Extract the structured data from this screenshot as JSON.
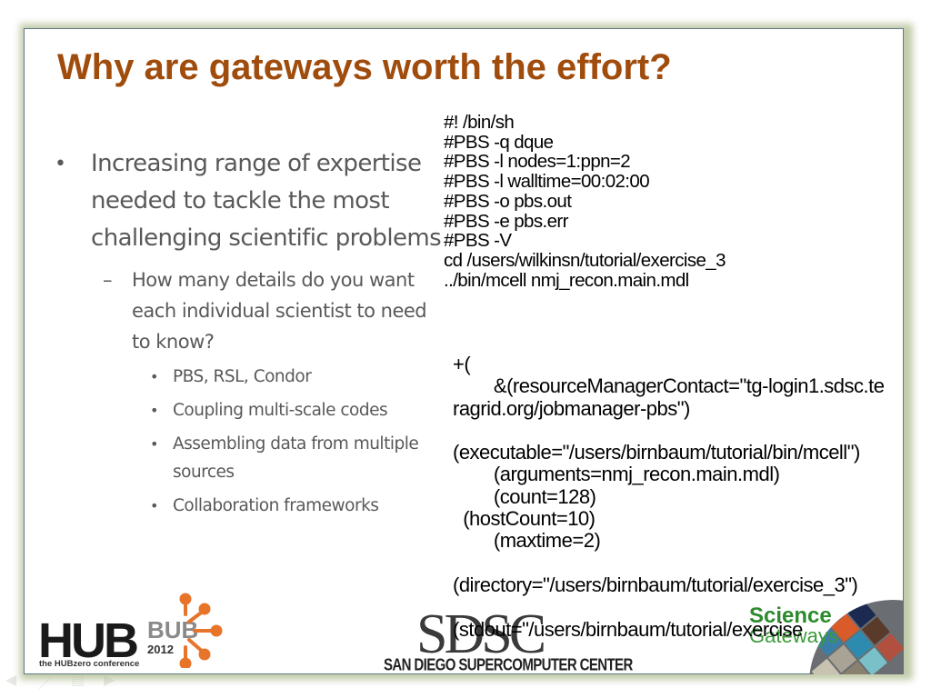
{
  "slide": {
    "title": "Why are gateways worth the effort?",
    "bullets": {
      "level1": {
        "marker": "•",
        "text": "Increasing range of expertise needed to tackle the most challenging scientific problems"
      },
      "level2": {
        "marker": "–",
        "text": "How many details do you want each individual scientist to need to know?"
      },
      "level3": [
        {
          "marker": "•",
          "text": "PBS, RSL, Condor"
        },
        {
          "marker": "•",
          "text": "Coupling multi-scale codes"
        },
        {
          "marker": "•",
          "text": "Assembling data from multiple sources"
        },
        {
          "marker": "•",
          "text": "Collaboration frameworks"
        }
      ]
    },
    "pbs_script": "#! /bin/sh\n#PBS -q dque\n#PBS -l nodes=1:ppn=2\n#PBS -l walltime=00:02:00\n#PBS -o pbs.out\n#PBS -e pbs.err\n#PBS -V\ncd /users/wilkinsn/tutorial/exercise_3\n../bin/mcell nmj_recon.main.mdl",
    "rsl_script": "+(\n        &(resourceManagerContact=\"tg-login1.sdsc.teragrid.org/jobmanager-pbs\")\n\n(executable=\"/users/birnbaum/tutorial/bin/mcell\")\n        (arguments=nmj_recon.main.mdl)\n        (count=128)\n  (hostCount=10)\n        (maxtime=2)\n\n(directory=\"/users/birnbaum/tutorial/exercise_3\")\n\n(stdout=\"/users/birnbaum/tutorial/exercise"
  },
  "logos": {
    "hubbub": {
      "main": "HUB",
      "secondary": "BUB",
      "year": "2012",
      "tagline": "the HUBzero conference",
      "accent": "#e8742a"
    },
    "sdsc": {
      "main": "SDSC",
      "subtitle": "SAN DIEGO SUPERCOMPUTER CENTER"
    },
    "science_gateways": {
      "line1": "Science",
      "line2": "Gateways",
      "color": "#2d8a2d"
    }
  },
  "navigation": {
    "prev_icon": "arrow-left-icon",
    "pen_icon": "pen-icon",
    "menu_icon": "menu-icon",
    "next_icon": "arrow-right-icon"
  }
}
